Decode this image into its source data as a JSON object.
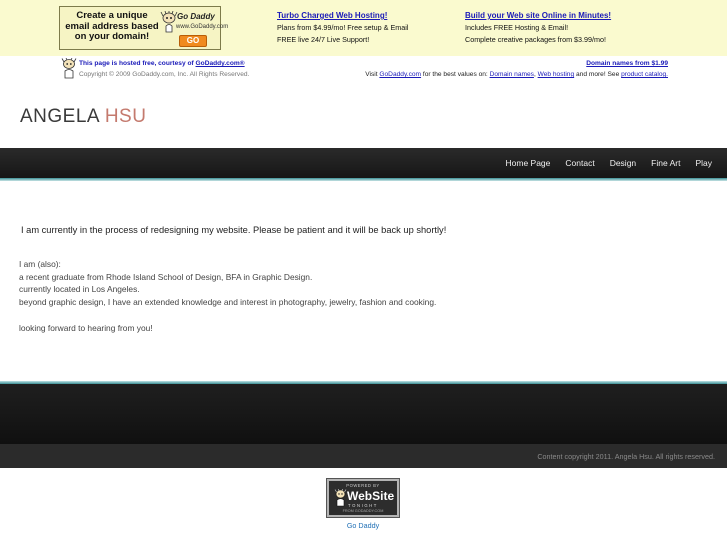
{
  "ad_banner": {
    "lines": [
      "Create a unique",
      "email address based",
      "on your domain!"
    ],
    "logo_name": "Go Daddy",
    "logo_url": "www.GoDaddy.com",
    "button_label": "GO"
  },
  "promos": [
    {
      "title": "Turbo Charged Web Hosting!",
      "lines": [
        "Plans from $4.99/mo! Free setup & Email",
        "FREE live 24/7 Live Support!"
      ]
    },
    {
      "title": "Build your Web site Online in Minutes!",
      "lines": [
        "Includes FREE Hosting & Email!",
        "Complete creative packages from $3.99/mo!"
      ]
    }
  ],
  "hosting_notice": {
    "prefix": "This page is hosted free, courtesy of ",
    "link": "GoDaddy.com®",
    "copyright": "Copyright © 2009 GoDaddy.com, Inc. All Rights Reserved.",
    "domain_link": "Domain names from $1.99",
    "visit_prefix": "Visit ",
    "visit_link": "GoDaddy.com",
    "visit_mid": " for the best values on: ",
    "visit_link_domains": "Domain names",
    "visit_comma": ", ",
    "visit_link_hosting": "Web hosting",
    "visit_more": " and more! See ",
    "visit_link_catalog": "product catalog."
  },
  "site": {
    "logo_first": "ANGELA",
    "logo_last": "HSU"
  },
  "nav": {
    "items": [
      "Home Page",
      "Contact",
      "Design",
      "Fine Art",
      "Play"
    ]
  },
  "main": {
    "notice": "I am currently in the process of redesigning my website. Please be patient and it will be back up shortly!",
    "bio_intro": "I am (also):",
    "bio_lines": [
      "a recent graduate from Rhode Island School of Design, BFA in Graphic Design.",
      "currently located in Los Angeles.",
      "beyond graphic design, I have an extended knowledge and interest in photography, jewelry, fashion and cooking."
    ],
    "closing": "looking forward to hearing from you!"
  },
  "footer": {
    "copyright": "Content copyright 2011. Angela Hsu. All rights reserved."
  },
  "badge": {
    "powered": "POWERED BY",
    "name": "WebSite",
    "tagline": "TONIGHT",
    "url": "FROM GODADDY.COM",
    "caption": "Go Daddy"
  },
  "colors": {
    "ad_band": "#fafacf",
    "link_blue": "#1a1ab8",
    "nav_bg": "#1c1c1c",
    "accent_teal": "#3b8f95",
    "logo_last": "#c47a6e"
  }
}
